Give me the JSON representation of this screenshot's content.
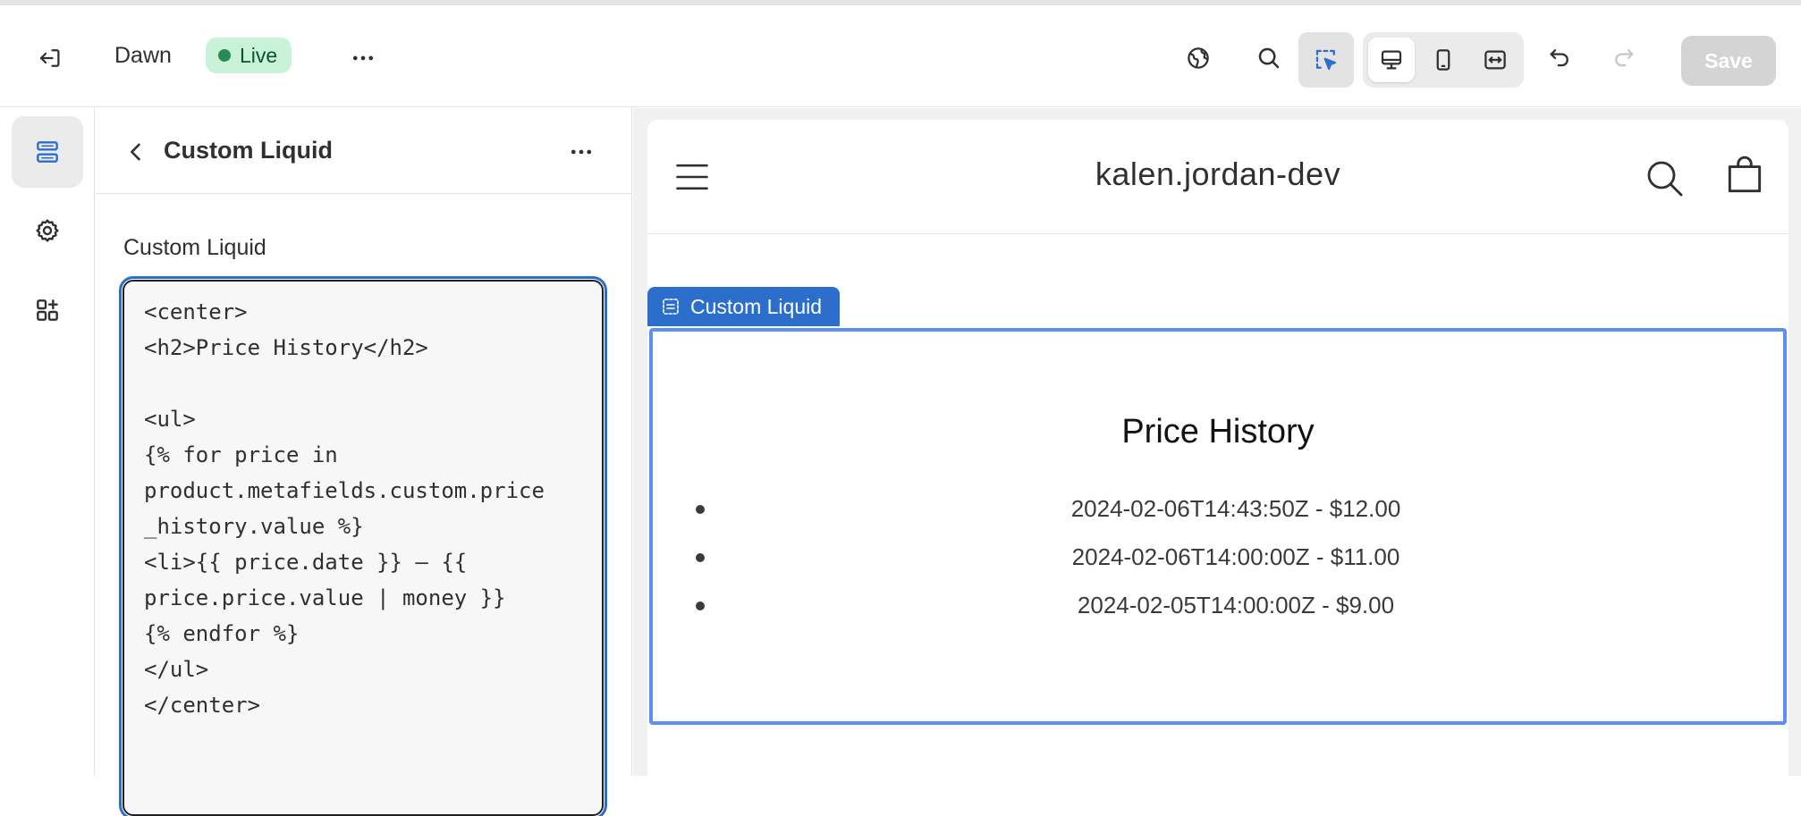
{
  "topbar": {
    "theme_name": "Dawn",
    "status_badge": "Live",
    "save_label": "Save"
  },
  "icons": {
    "exit": "exit-icon",
    "more": "more-horizontal-icon",
    "globe": "globe-icon",
    "search": "search-icon",
    "inspector": "select-cursor-icon",
    "desktop": "desktop-icon",
    "mobile": "mobile-icon",
    "fullscreen": "fullscreen-icon",
    "undo": "undo-icon",
    "redo": "redo-icon"
  },
  "colors": {
    "accent": "#2c6ecb",
    "live_badge_bg": "#c9f3d9",
    "live_dot": "#2a8a55",
    "selection_outline": "#5b8ff0"
  },
  "rail": {
    "items": [
      "sections-icon",
      "settings-icon",
      "apps-icon"
    ]
  },
  "panel": {
    "title": "Custom Liquid",
    "field_label": "Custom Liquid",
    "code": "<center>\n<h2>Price History</h2>\n\n<ul>\n{% for price in\nproduct.metafields.custom.price\n_history.value %}\n<li>{{ price.date }} – {{\nprice.price.value | money }}\n{% endfor %}\n</ul>\n</center>"
  },
  "preview": {
    "store_name": "kalen.jordan-dev",
    "section_tag": "Custom Liquid",
    "heading": "Price History",
    "items": [
      "2024-02-06T14:43:50Z - $12.00",
      "2024-02-06T14:00:00Z - $11.00",
      "2024-02-05T14:00:00Z - $9.00"
    ]
  }
}
